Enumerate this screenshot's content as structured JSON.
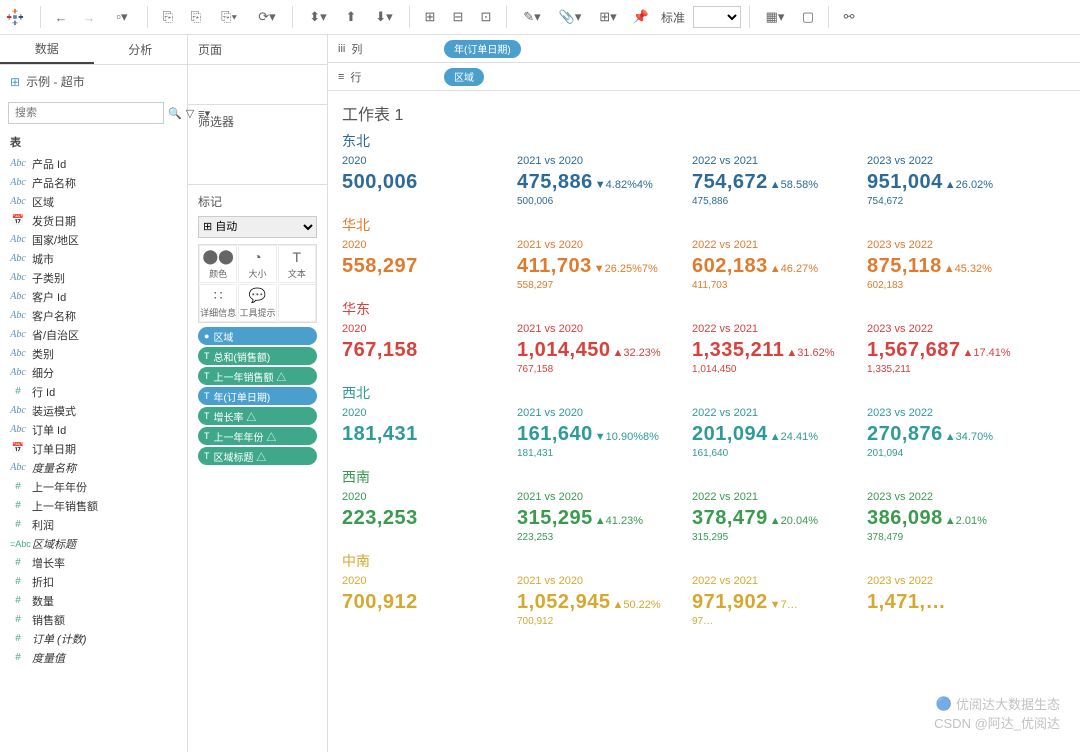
{
  "toolbar": {
    "standard": "标准"
  },
  "tabs": {
    "data": "数据",
    "analysis": "分析"
  },
  "datasource": {
    "name": "示例 - 超市"
  },
  "search": {
    "placeholder": "搜索"
  },
  "sections": {
    "tables": "表"
  },
  "fields": {
    "dims": [
      {
        "icon": "abc",
        "name": "产品 Id"
      },
      {
        "icon": "abc",
        "name": "产品名称"
      },
      {
        "icon": "abc",
        "name": "区域"
      },
      {
        "icon": "date",
        "name": "发货日期"
      },
      {
        "icon": "abc",
        "name": "国家/地区"
      },
      {
        "icon": "abc",
        "name": "城市"
      },
      {
        "icon": "abc",
        "name": "子类别"
      },
      {
        "icon": "abc",
        "name": "客户 Id"
      },
      {
        "icon": "abc",
        "name": "客户名称"
      },
      {
        "icon": "abc",
        "name": "省/自治区"
      },
      {
        "icon": "abc",
        "name": "类别"
      },
      {
        "icon": "abc",
        "name": "细分"
      },
      {
        "icon": "num",
        "name": "行 Id"
      },
      {
        "icon": "abc",
        "name": "装运模式"
      },
      {
        "icon": "abc",
        "name": "订单 Id"
      },
      {
        "icon": "date",
        "name": "订单日期"
      },
      {
        "icon": "abc",
        "name": "度量名称",
        "italic": true
      }
    ],
    "meas": [
      {
        "icon": "num",
        "name": "上一年年份"
      },
      {
        "icon": "num",
        "name": "上一年销售额"
      },
      {
        "icon": "num",
        "name": "利润"
      },
      {
        "icon": "numabc",
        "name": "区域标题",
        "italic": true
      },
      {
        "icon": "num",
        "name": "增长率"
      },
      {
        "icon": "num",
        "name": "折扣"
      },
      {
        "icon": "num",
        "name": "数量"
      },
      {
        "icon": "num",
        "name": "销售额"
      },
      {
        "icon": "num",
        "name": "订单 (计数)",
        "italic": true
      },
      {
        "icon": "num",
        "name": "度量值",
        "italic": true
      }
    ]
  },
  "shelves": {
    "pages": "页面",
    "filters": "筛选器",
    "marks": "标记",
    "auto": "自动",
    "color": "颜色",
    "size": "大小",
    "text": "文本",
    "detail": "详细信息",
    "tooltip": "工具提示",
    "columns": "列",
    "rows": "行",
    "col_pill": "年(订单日期)",
    "row_pill": "区域"
  },
  "mark_pills": [
    {
      "cls": "blue",
      "icon": "●",
      "label": "区域"
    },
    {
      "cls": "green",
      "icon": "T",
      "label": "总和(销售额)"
    },
    {
      "cls": "green",
      "icon": "T",
      "label": "上一年销售额  △"
    },
    {
      "cls": "blue",
      "icon": "T",
      "label": "年(订单日期)"
    },
    {
      "cls": "green",
      "icon": "T",
      "label": "增长率        △"
    },
    {
      "cls": "green",
      "icon": "T",
      "label": "上一年年份    △"
    },
    {
      "cls": "green",
      "icon": "T",
      "label": "区域标题      △"
    }
  ],
  "viz": {
    "title": "工作表 1",
    "year_labels": [
      "2020",
      "2021 vs 2020",
      "2022 vs 2021",
      "2023 vs 2022"
    ],
    "regions": [
      {
        "name": "东北",
        "color": "c-blue",
        "cells": [
          {
            "val": "500,006",
            "delta": "",
            "prev": ""
          },
          {
            "val": "475,886",
            "delta": "▼4.82%4%",
            "prev": "500,006"
          },
          {
            "val": "754,672",
            "delta": "▲58.58%",
            "prev": "475,886"
          },
          {
            "val": "951,004",
            "delta": "▲26.02%",
            "prev": "754,672"
          }
        ]
      },
      {
        "name": "华北",
        "color": "c-orange",
        "cells": [
          {
            "val": "558,297",
            "delta": "",
            "prev": ""
          },
          {
            "val": "411,703",
            "delta": "▼26.25%7%",
            "prev": "558,297"
          },
          {
            "val": "602,183",
            "delta": "▲46.27%",
            "prev": "411,703"
          },
          {
            "val": "875,118",
            "delta": "▲45.32%",
            "prev": "602,183"
          }
        ]
      },
      {
        "name": "华东",
        "color": "c-red",
        "cells": [
          {
            "val": "767,158",
            "delta": "",
            "prev": ""
          },
          {
            "val": "1,014,450",
            "delta": "▲32.23%",
            "prev": "767,158"
          },
          {
            "val": "1,335,211",
            "delta": "▲31.62%",
            "prev": "1,014,450"
          },
          {
            "val": "1,567,687",
            "delta": "▲17.41%",
            "prev": "1,335,211"
          }
        ]
      },
      {
        "name": "西北",
        "color": "c-teal",
        "cells": [
          {
            "val": "181,431",
            "delta": "",
            "prev": ""
          },
          {
            "val": "161,640",
            "delta": "▼10.90%8%",
            "prev": "181,431"
          },
          {
            "val": "201,094",
            "delta": "▲24.41%",
            "prev": "161,640"
          },
          {
            "val": "270,876",
            "delta": "▲34.70%",
            "prev": "201,094"
          }
        ]
      },
      {
        "name": "西南",
        "color": "c-green",
        "cells": [
          {
            "val": "223,253",
            "delta": "",
            "prev": ""
          },
          {
            "val": "315,295",
            "delta": "▲41.23%",
            "prev": "223,253"
          },
          {
            "val": "378,479",
            "delta": "▲20.04%",
            "prev": "315,295"
          },
          {
            "val": "386,098",
            "delta": "▲2.01%",
            "prev": "378,479"
          }
        ]
      },
      {
        "name": "中南",
        "color": "c-gold",
        "cells": [
          {
            "val": "700,912",
            "delta": "",
            "prev": ""
          },
          {
            "val": "1,052,945",
            "delta": "▲50.22%",
            "prev": "700,912"
          },
          {
            "val": "971,902",
            "delta": "▼7…",
            "prev": "97…"
          },
          {
            "val": "1,471,…",
            "delta": "",
            "prev": ""
          }
        ]
      }
    ]
  },
  "watermark": {
    "line1": "优阅达大数据生态",
    "line2": "CSDN @阿达_优阅达"
  }
}
